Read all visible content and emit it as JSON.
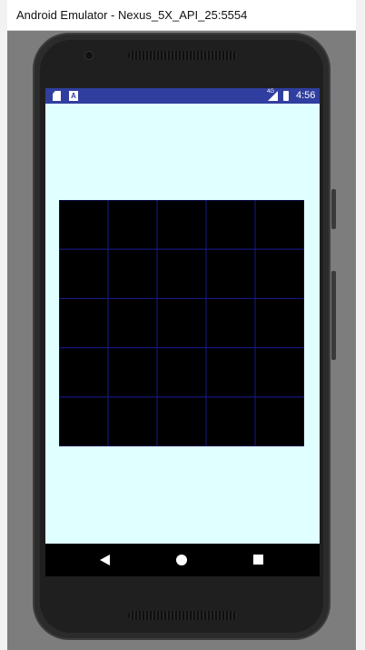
{
  "window": {
    "title": "Android Emulator - Nexus_5X_API_25:5554"
  },
  "statusbar": {
    "time": "4:56",
    "network": "4G",
    "icons": [
      "sd-card-icon",
      "notification-a-icon",
      "signal-icon",
      "battery-icon"
    ],
    "color": "#303f9f"
  },
  "screen": {
    "background": "#e0ffff"
  },
  "board": {
    "rows": 5,
    "cols": 5,
    "cell_color": "#000000",
    "line_color": "#1a1a8c"
  },
  "navbar": {
    "icons": [
      "back-icon",
      "home-icon",
      "recents-icon"
    ]
  }
}
